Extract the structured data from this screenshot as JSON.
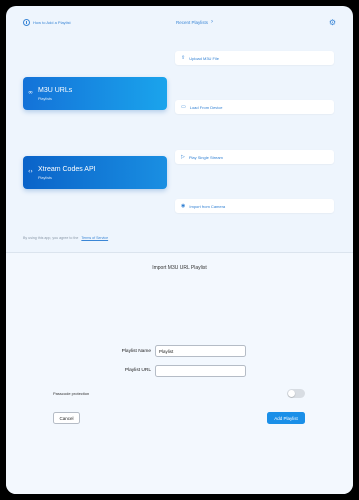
{
  "top": {
    "help_link": "How to Add a Playlist",
    "recent_link": "Recent Playlists",
    "recent_chevron": "›",
    "settings_icon": "gear-icon",
    "cards": [
      {
        "title": "M3U URLs",
        "subtitle": "Playlists",
        "icon": "link-icon"
      },
      {
        "title": "Xtream Codes API",
        "subtitle": "Playlists",
        "icon": "code-icon"
      }
    ],
    "actions": [
      {
        "label": "Upload M3U File",
        "icon": "upload-icon"
      },
      {
        "label": "Load From Device",
        "icon": "folder-icon"
      },
      {
        "label": "Play Single Stream",
        "icon": "play-icon"
      },
      {
        "label": "Import from Camera",
        "icon": "camera-icon"
      }
    ],
    "terms_text": "By using this app, you agree to the",
    "terms_link": "Terms of Service"
  },
  "sheet": {
    "title": "Import M3U URL Playlist",
    "name_label": "Playlist Name",
    "name_value": "Playlist",
    "url_label": "Playlist URL",
    "url_value": "",
    "passcode_label": "Passcode protection",
    "passcode_enabled": false,
    "cancel_label": "Cancel",
    "add_label": "Add Playlist"
  }
}
